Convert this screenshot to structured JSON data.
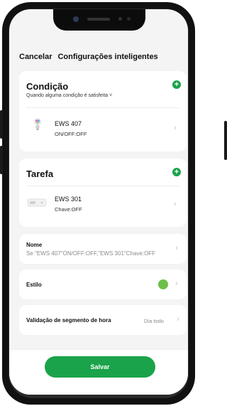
{
  "header": {
    "cancel_label": "Cancelar",
    "title": "Configurações inteligentes"
  },
  "condition": {
    "title": "Condição",
    "subtitle": "Quando alguma condição é satisfeita",
    "subtitle_caret": "˅",
    "add_icon": "plus-icon",
    "device": {
      "name": "EWS 407",
      "state": "ON/OFF:OFF",
      "icon": "light-bulb-icon"
    }
  },
  "task": {
    "title": "Tarefa",
    "add_icon": "plus-icon",
    "device": {
      "name": "EWS 301",
      "state": "Chave:OFF",
      "icon": "switch-device-icon"
    }
  },
  "name_row": {
    "label": "Nome",
    "value": "Se \"EWS 407\"ON/OFF:OFF,\"EWS 301\"Chave:OFF"
  },
  "style_row": {
    "label": "Estilo",
    "color": "#6cc04a"
  },
  "time_row": {
    "label": "Validação de segmento de hora",
    "value": "Dia todo"
  },
  "save_label": "Salvar",
  "colors": {
    "accent": "#1aa34a",
    "chevron": "#c4c4c4"
  }
}
